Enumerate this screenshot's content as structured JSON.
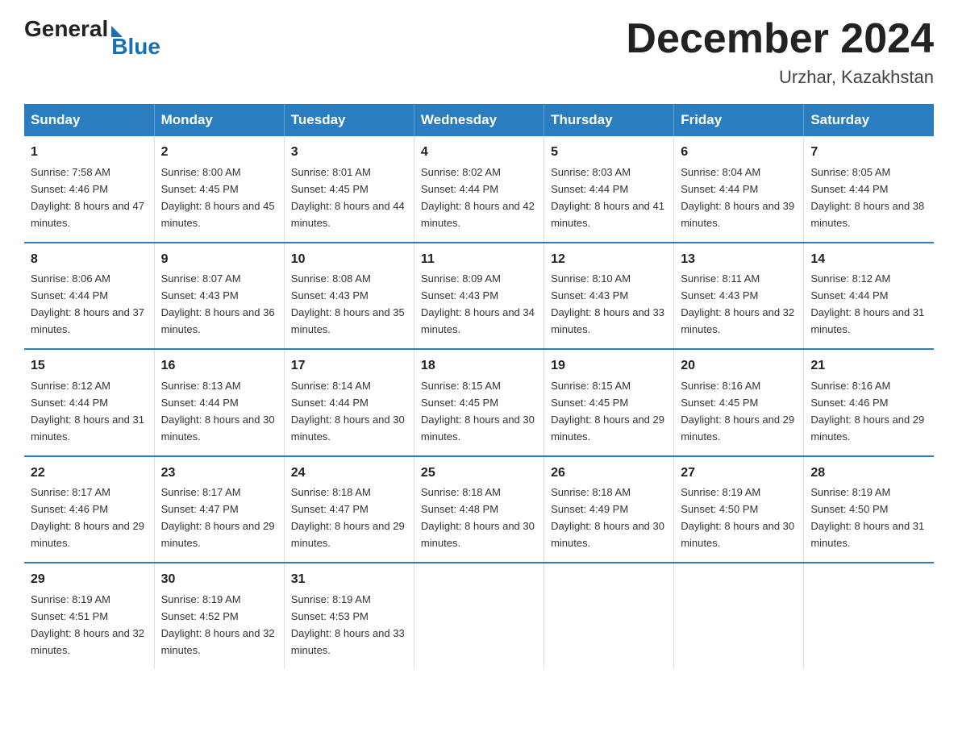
{
  "header": {
    "logo_general": "General",
    "logo_blue": "Blue",
    "main_title": "December 2024",
    "subtitle": "Urzhar, Kazakhstan"
  },
  "days_of_week": [
    "Sunday",
    "Monday",
    "Tuesday",
    "Wednesday",
    "Thursday",
    "Friday",
    "Saturday"
  ],
  "weeks": [
    [
      {
        "day": "1",
        "sunrise": "7:58 AM",
        "sunset": "4:46 PM",
        "daylight": "8 hours and 47 minutes."
      },
      {
        "day": "2",
        "sunrise": "8:00 AM",
        "sunset": "4:45 PM",
        "daylight": "8 hours and 45 minutes."
      },
      {
        "day": "3",
        "sunrise": "8:01 AM",
        "sunset": "4:45 PM",
        "daylight": "8 hours and 44 minutes."
      },
      {
        "day": "4",
        "sunrise": "8:02 AM",
        "sunset": "4:44 PM",
        "daylight": "8 hours and 42 minutes."
      },
      {
        "day": "5",
        "sunrise": "8:03 AM",
        "sunset": "4:44 PM",
        "daylight": "8 hours and 41 minutes."
      },
      {
        "day": "6",
        "sunrise": "8:04 AM",
        "sunset": "4:44 PM",
        "daylight": "8 hours and 39 minutes."
      },
      {
        "day": "7",
        "sunrise": "8:05 AM",
        "sunset": "4:44 PM",
        "daylight": "8 hours and 38 minutes."
      }
    ],
    [
      {
        "day": "8",
        "sunrise": "8:06 AM",
        "sunset": "4:44 PM",
        "daylight": "8 hours and 37 minutes."
      },
      {
        "day": "9",
        "sunrise": "8:07 AM",
        "sunset": "4:43 PM",
        "daylight": "8 hours and 36 minutes."
      },
      {
        "day": "10",
        "sunrise": "8:08 AM",
        "sunset": "4:43 PM",
        "daylight": "8 hours and 35 minutes."
      },
      {
        "day": "11",
        "sunrise": "8:09 AM",
        "sunset": "4:43 PM",
        "daylight": "8 hours and 34 minutes."
      },
      {
        "day": "12",
        "sunrise": "8:10 AM",
        "sunset": "4:43 PM",
        "daylight": "8 hours and 33 minutes."
      },
      {
        "day": "13",
        "sunrise": "8:11 AM",
        "sunset": "4:43 PM",
        "daylight": "8 hours and 32 minutes."
      },
      {
        "day": "14",
        "sunrise": "8:12 AM",
        "sunset": "4:44 PM",
        "daylight": "8 hours and 31 minutes."
      }
    ],
    [
      {
        "day": "15",
        "sunrise": "8:12 AM",
        "sunset": "4:44 PM",
        "daylight": "8 hours and 31 minutes."
      },
      {
        "day": "16",
        "sunrise": "8:13 AM",
        "sunset": "4:44 PM",
        "daylight": "8 hours and 30 minutes."
      },
      {
        "day": "17",
        "sunrise": "8:14 AM",
        "sunset": "4:44 PM",
        "daylight": "8 hours and 30 minutes."
      },
      {
        "day": "18",
        "sunrise": "8:15 AM",
        "sunset": "4:45 PM",
        "daylight": "8 hours and 30 minutes."
      },
      {
        "day": "19",
        "sunrise": "8:15 AM",
        "sunset": "4:45 PM",
        "daylight": "8 hours and 29 minutes."
      },
      {
        "day": "20",
        "sunrise": "8:16 AM",
        "sunset": "4:45 PM",
        "daylight": "8 hours and 29 minutes."
      },
      {
        "day": "21",
        "sunrise": "8:16 AM",
        "sunset": "4:46 PM",
        "daylight": "8 hours and 29 minutes."
      }
    ],
    [
      {
        "day": "22",
        "sunrise": "8:17 AM",
        "sunset": "4:46 PM",
        "daylight": "8 hours and 29 minutes."
      },
      {
        "day": "23",
        "sunrise": "8:17 AM",
        "sunset": "4:47 PM",
        "daylight": "8 hours and 29 minutes."
      },
      {
        "day": "24",
        "sunrise": "8:18 AM",
        "sunset": "4:47 PM",
        "daylight": "8 hours and 29 minutes."
      },
      {
        "day": "25",
        "sunrise": "8:18 AM",
        "sunset": "4:48 PM",
        "daylight": "8 hours and 30 minutes."
      },
      {
        "day": "26",
        "sunrise": "8:18 AM",
        "sunset": "4:49 PM",
        "daylight": "8 hours and 30 minutes."
      },
      {
        "day": "27",
        "sunrise": "8:19 AM",
        "sunset": "4:50 PM",
        "daylight": "8 hours and 30 minutes."
      },
      {
        "day": "28",
        "sunrise": "8:19 AM",
        "sunset": "4:50 PM",
        "daylight": "8 hours and 31 minutes."
      }
    ],
    [
      {
        "day": "29",
        "sunrise": "8:19 AM",
        "sunset": "4:51 PM",
        "daylight": "8 hours and 32 minutes."
      },
      {
        "day": "30",
        "sunrise": "8:19 AM",
        "sunset": "4:52 PM",
        "daylight": "8 hours and 32 minutes."
      },
      {
        "day": "31",
        "sunrise": "8:19 AM",
        "sunset": "4:53 PM",
        "daylight": "8 hours and 33 minutes."
      },
      null,
      null,
      null,
      null
    ]
  ],
  "labels": {
    "sunrise": "Sunrise:",
    "sunset": "Sunset:",
    "daylight": "Daylight:"
  }
}
